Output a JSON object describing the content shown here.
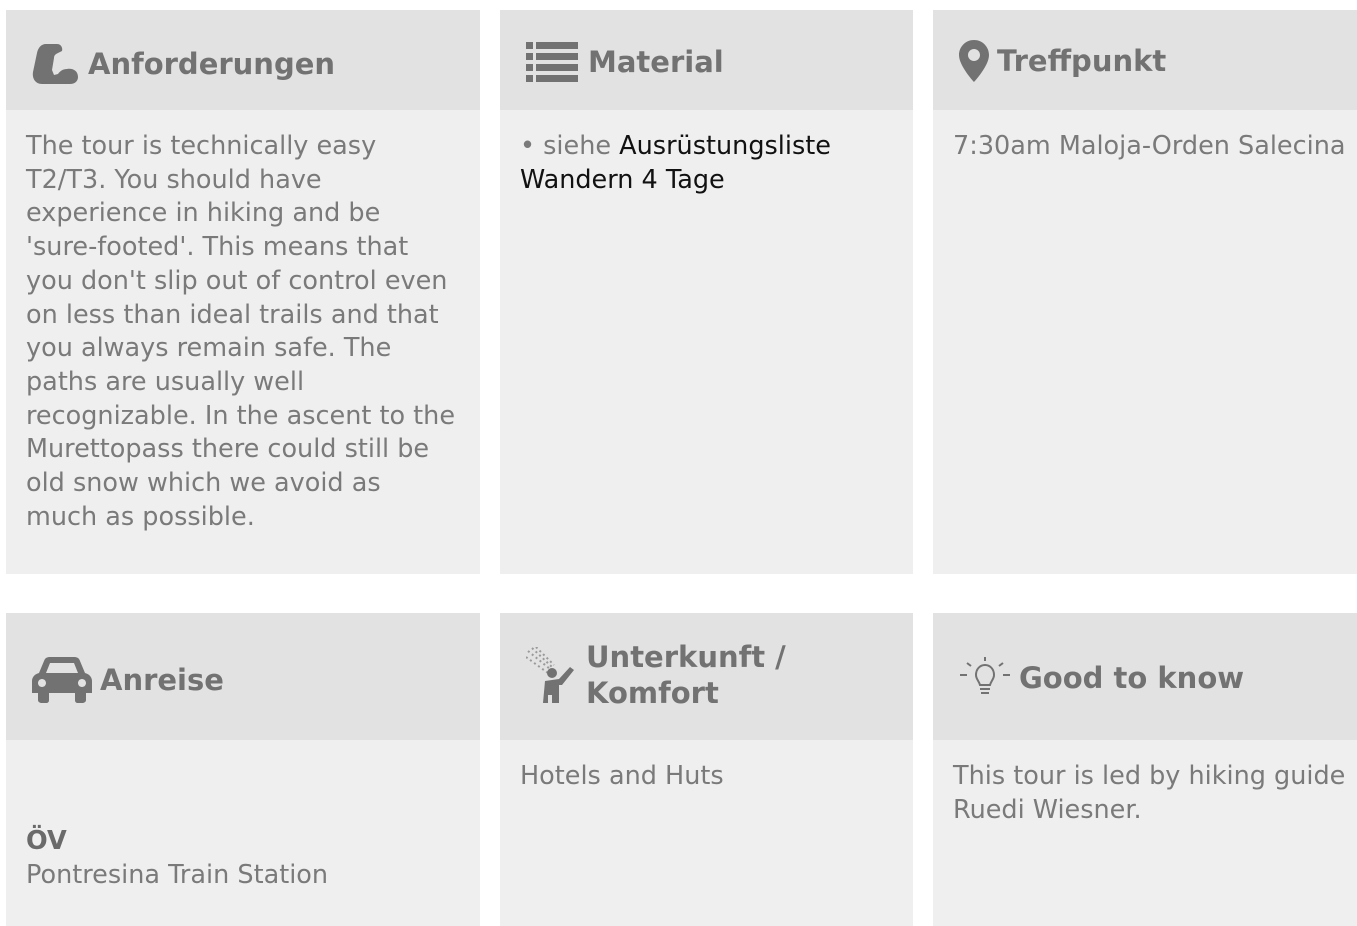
{
  "cards": {
    "anforderungen": {
      "title": "Anforderungen",
      "icon": "flexed-arm-icon",
      "body": "The tour is technically easy T2/T3. You should have experience in hiking and be 'sure-footed'. This means that you don't slip out of control even on less than ideal trails and that you always remain safe. The paths are usually well recognizable. In the ascent to the Murettopass there could still be old snow which we avoid as much as possible."
    },
    "material": {
      "title": "Material",
      "icon": "list-icon",
      "bullet_prefix": "• siehe ",
      "link_text": "Ausrüstungsliste Wandern 4 Tage"
    },
    "treffpunkt": {
      "title": "Treffpunkt",
      "icon": "map-pin-icon",
      "body": "7:30am Maloja-Orden Salecina"
    },
    "anreise": {
      "title": "Anreise",
      "icon": "car-icon",
      "subheading": "ÖV",
      "body": "Pontresina Train Station"
    },
    "unterkunft": {
      "title_line1": "Unterkunft /",
      "title_line2": "Komfort",
      "icon": "shower-icon",
      "body": "Hotels and Huts"
    },
    "good_to_know": {
      "title": "Good to know",
      "icon": "lightbulb-icon",
      "body": "This tour is led by hiking guide Ruedi Wiesner."
    }
  },
  "colors": {
    "card_bg": "#efefef",
    "header_bg": "#e2e2e2",
    "title_text": "#727272",
    "body_text": "#7a7a7a",
    "link_text": "#111111"
  }
}
